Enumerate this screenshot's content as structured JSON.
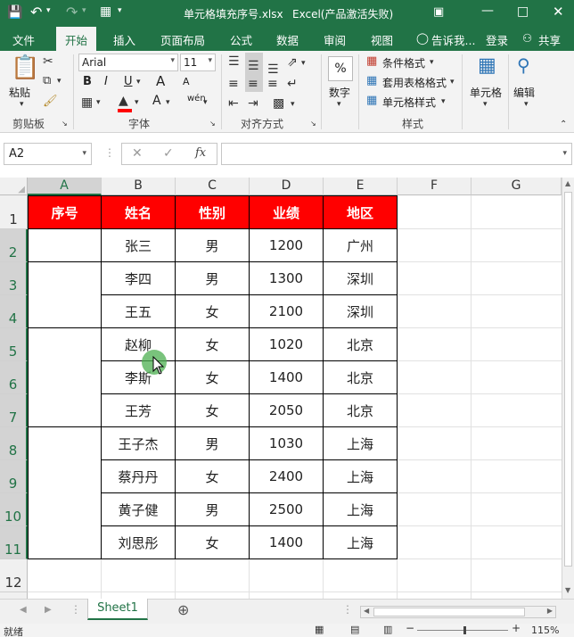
{
  "title": {
    "filename": "单元格填充序号.xlsx",
    "app": "Excel(产品激活失败)"
  },
  "tabs": [
    "文件",
    "开始",
    "插入",
    "页面布局",
    "公式",
    "数据",
    "审阅",
    "视图"
  ],
  "tell_me": "告诉我...",
  "login": "登录",
  "share": "共享",
  "ribbon": {
    "paste": "粘贴",
    "font_name": "Arial",
    "font_size": "11",
    "bold": "B",
    "italic": "I",
    "underline": "U",
    "grow_font": "A",
    "shrink_font": "A",
    "font_color_letter": "A",
    "wen": "wén",
    "number_label": "数字",
    "percent": "%",
    "cond_format": "条件格式",
    "table_format": "套用表格格式",
    "cell_style": "单元格样式",
    "cells": "单元格",
    "editing": "编辑",
    "groups": {
      "clipboard": "剪贴板",
      "font": "字体",
      "alignment": "对齐方式",
      "styles": "样式"
    }
  },
  "namebox": "A2",
  "fx": "fx",
  "columns": [
    "A",
    "B",
    "C",
    "D",
    "E",
    "F",
    "G"
  ],
  "rows": [
    "1",
    "2",
    "3",
    "4",
    "5",
    "6",
    "7",
    "8",
    "9",
    "10",
    "11",
    "12"
  ],
  "table": {
    "headers": [
      "序号",
      "姓名",
      "性别",
      "业绩",
      "地区"
    ],
    "data": [
      [
        "张三",
        "男",
        "1200",
        "广州"
      ],
      [
        "李四",
        "男",
        "1300",
        "深圳"
      ],
      [
        "王五",
        "女",
        "2100",
        "深圳"
      ],
      [
        "赵柳",
        "女",
        "1020",
        "北京"
      ],
      [
        "李斯",
        "女",
        "1400",
        "北京"
      ],
      [
        "王芳",
        "女",
        "2050",
        "北京"
      ],
      [
        "王子杰",
        "男",
        "1030",
        "上海"
      ],
      [
        "蔡丹丹",
        "女",
        "2400",
        "上海"
      ],
      [
        "黄子健",
        "男",
        "2500",
        "上海"
      ],
      [
        "刘思彤",
        "女",
        "1400",
        "上海"
      ]
    ]
  },
  "sheet_tab": "Sheet1",
  "status": {
    "ready": "就绪",
    "zoom": "115%"
  },
  "colors": {
    "brand": "#217346",
    "header_fill": "#ff0000",
    "cursor_dot": "#4caf50"
  }
}
